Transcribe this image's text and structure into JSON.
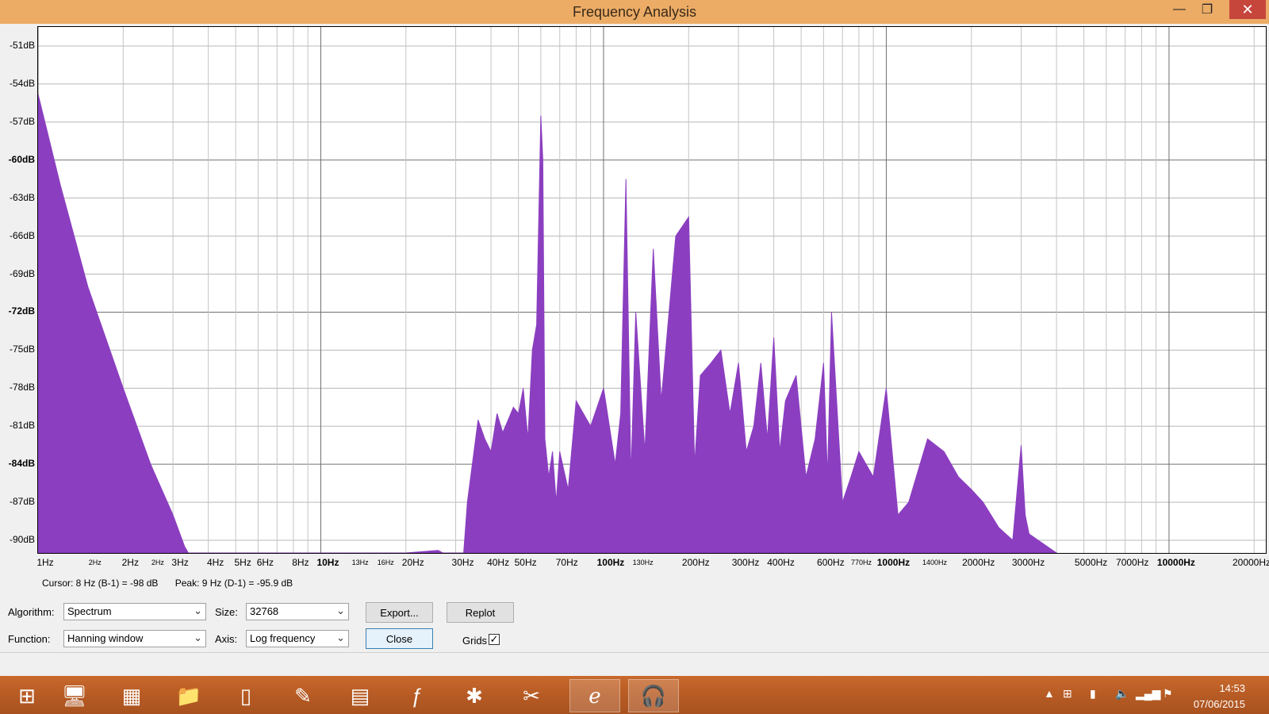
{
  "window": {
    "title": "Frequency Analysis",
    "minimize": "—",
    "maximize": "❐",
    "close": "✕"
  },
  "plot": {
    "y_labels": [
      "-51dB",
      "-54dB",
      "-57dB",
      "-60dB",
      "-63dB",
      "-66dB",
      "-69dB",
      "-72dB",
      "-75dB",
      "-78dB",
      "-81dB",
      "-84dB",
      "-87dB",
      "-90dB"
    ],
    "x_labels": [
      "1Hz",
      "2Hz",
      "2Hz",
      "2Hz",
      "3Hz",
      "4Hz",
      "5Hz",
      "6Hz",
      "8Hz",
      "10Hz",
      "13Hz",
      "16Hz",
      "20Hz",
      "30Hz",
      "40Hz",
      "50Hz",
      "70Hz",
      "100Hz",
      "130Hz",
      "200Hz",
      "300Hz",
      "400Hz",
      "600Hz",
      "770Hz",
      "1000Hz",
      "1400Hz",
      "2000Hz",
      "3000Hz",
      "5000Hz",
      "7000Hz",
      "10000Hz",
      "20000Hz"
    ],
    "fill_color": "#8b3fc0"
  },
  "chart_data": {
    "type": "area",
    "x_scale": "log",
    "xlim": [
      1,
      22000
    ],
    "ylim": [
      -91,
      -49.5
    ],
    "ylabel": "",
    "xlabel": "",
    "grid": true,
    "x": [
      1,
      1.2,
      1.5,
      2,
      2.5,
      3,
      3.3,
      3.4,
      20,
      26,
      27,
      32,
      33,
      36,
      38,
      40,
      42,
      44,
      46,
      48,
      50,
      52,
      54,
      56,
      58,
      60,
      61,
      62,
      64,
      66,
      68,
      70,
      75,
      80,
      90,
      100,
      110,
      115,
      120,
      125,
      130,
      140,
      150,
      160,
      180,
      200,
      210,
      220,
      240,
      260,
      280,
      300,
      320,
      340,
      360,
      380,
      400,
      420,
      440,
      480,
      520,
      560,
      600,
      620,
      640,
      700,
      750,
      800,
      900,
      1000,
      1100,
      1200,
      1400,
      1600,
      1800,
      2000,
      2200,
      2500,
      2800,
      3000,
      3100,
      3200,
      4000
    ],
    "y": [
      -54.8,
      -62,
      -70,
      -78,
      -84,
      -88,
      -90.5,
      -91,
      -91,
      -90.8,
      -91,
      -91,
      -87,
      -80.5,
      -82,
      -83,
      -80,
      -81.5,
      -80.5,
      -79.5,
      -80,
      -78,
      -82,
      -75,
      -73,
      -56.5,
      -60,
      -82,
      -85,
      -83,
      -87,
      -83,
      -86,
      -79,
      -81,
      -78,
      -84,
      -80,
      -61.5,
      -85,
      -72,
      -83,
      -67,
      -79,
      -66,
      -64.5,
      -84,
      -77,
      -76,
      -75,
      -80,
      -76,
      -83,
      -81,
      -76,
      -82,
      -74,
      -83,
      -79,
      -77,
      -85,
      -82,
      -76,
      -85,
      -72,
      -87,
      -85,
      -83,
      -85,
      -78,
      -88,
      -87,
      -82,
      -83,
      -85,
      -86,
      -87,
      -89,
      -90,
      -82.5,
      -88,
      -89.5,
      -91
    ]
  },
  "readout": {
    "cursor": "Cursor: 8 Hz (B-1) = -98 dB",
    "peak": "Peak: 9 Hz (D-1) = -95.9 dB"
  },
  "controls": {
    "algorithm_label": "Algorithm:",
    "algorithm_value": "Spectrum",
    "function_label": "Function:",
    "function_value": "Hanning window",
    "size_label": "Size:",
    "size_value": "32768",
    "axis_label": "Axis:",
    "axis_value": "Log frequency",
    "export": "Export...",
    "replot": "Replot",
    "close": "Close",
    "grids_label": "Grids",
    "grids_checked": true
  },
  "taskbar": {
    "clock_time": "14:53",
    "clock_date": "07/06/2015",
    "items": [
      "windows-start-icon",
      "network-icon",
      "firewall-icon",
      "folder-icon",
      "document-icon",
      "notepad-icon",
      "calculator-icon",
      "filezilla-icon",
      "virtual-gecko-icon",
      "paint-icon",
      "internet-explorer-icon",
      "audacity-icon"
    ]
  }
}
